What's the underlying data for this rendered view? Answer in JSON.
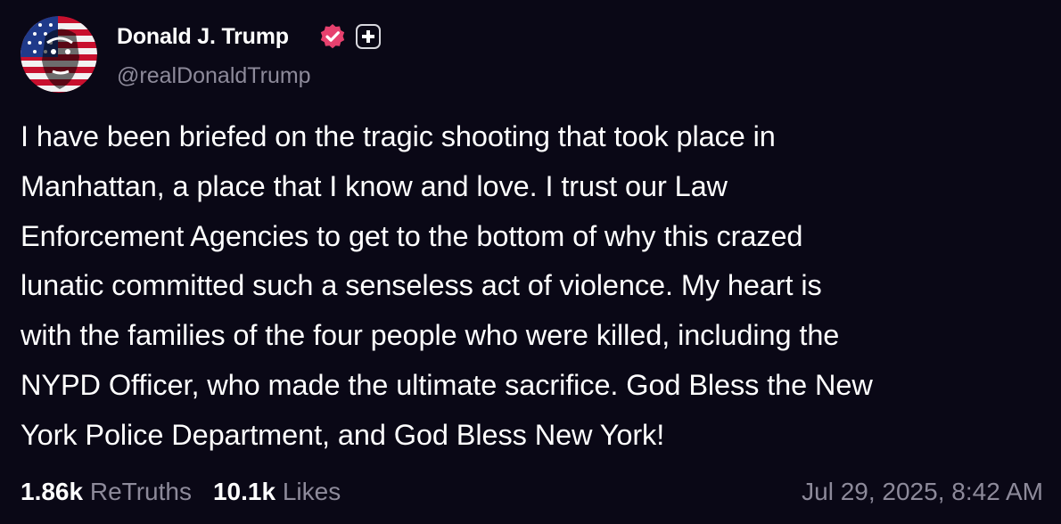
{
  "author": {
    "display_name": "Donald J. Trump",
    "handle": "@realDonaldTrump",
    "avatar_icon": "avatar-flag-portrait",
    "verified_icon": "verified-badge-icon",
    "verified_color": "#e6416e",
    "plus_icon": "plus-icon"
  },
  "post": {
    "text": "I have been briefed on the tragic shooting that took place in\nManhattan, a place that I know and love. I trust our Law\nEnforcement Agencies to get to the bottom of why this crazed\nlunatic committed such a senseless act of violence. My heart is\nwith the families of the four people who were killed, including the\nNYPD Officer, who made the ultimate sacrifice. God Bless the New\nYork Police Department, and God Bless New York!"
  },
  "stats": {
    "retruths_count": "1.86k",
    "retruths_label": "ReTruths",
    "likes_count": "10.1k",
    "likes_label": "Likes"
  },
  "timestamp": "Jul 29, 2025, 8:42 AM",
  "colors": {
    "background": "#0a0816",
    "text": "#ffffff",
    "muted": "#8d8a9a"
  }
}
